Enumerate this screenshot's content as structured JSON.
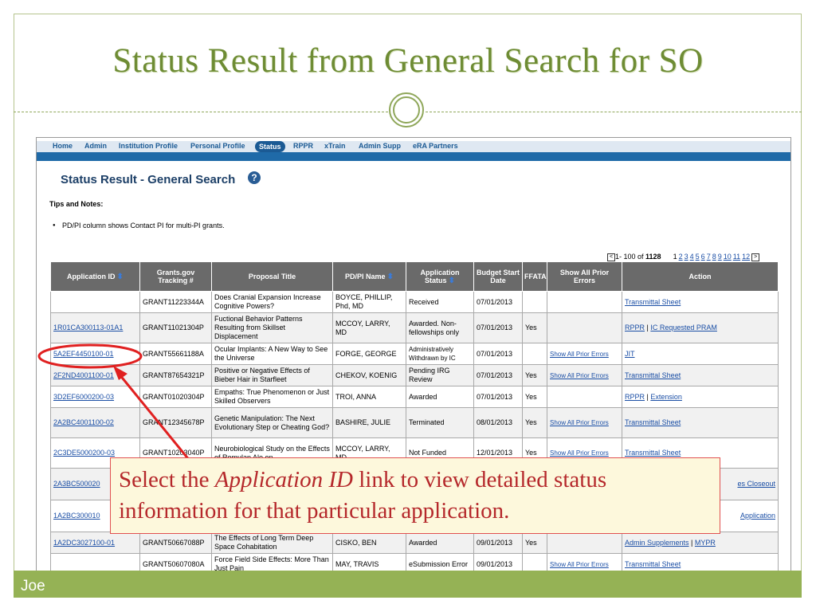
{
  "slide": {
    "title": "Status Result from General Search for SO",
    "footer": "Joe",
    "callout": {
      "pre": "Select the ",
      "emph": "Application ID",
      "post": " link to view detailed status information for that particular application."
    }
  },
  "colors": {
    "accent": "#6e8c34",
    "nav_blue": "#1f6aa8",
    "callout_text": "#b5282b",
    "highlight_circle": "#e02020"
  },
  "nav": {
    "items": [
      "Home",
      "Admin",
      "Institution Profile",
      "Personal Profile",
      "Status",
      "RPPR",
      "xTrain",
      "Admin Supp",
      "eRA Partners"
    ],
    "active": "Status"
  },
  "page": {
    "heading": "Status Result - General Search",
    "help_icon": "?",
    "tips_title": "Tips and Notes:",
    "tips": [
      "PD/PI column shows Contact PI for multi-PI grants."
    ]
  },
  "pager": {
    "range": "1- 100 of ",
    "total": "1128",
    "pages": [
      "1",
      "2",
      "3",
      "4",
      "5",
      "6",
      "7",
      "8",
      "9",
      "10",
      "11",
      "12"
    ]
  },
  "table": {
    "headers": [
      "Application ID",
      "Grants.gov Tracking #",
      "Proposal Title",
      "PD/PI Name",
      "Application Status",
      "Budget Start Date",
      "FFATA",
      "Show All Prior Errors",
      "Action"
    ],
    "rows": [
      {
        "app_id": "",
        "tracking": "GRANT11223344A",
        "title": "Does Cranial Expansion Increase Cognitive Powers?",
        "pi": "BOYCE, PHILLIP, Phd, MD",
        "status": "Received",
        "date": "07/01/2013",
        "ffata": "",
        "errors": "",
        "actions": [
          "Transmittal Sheet"
        ]
      },
      {
        "app_id": "1R01CA300113-01A1",
        "tracking": "GRANT11021304P",
        "title": "Fuctional Behavior Patterns Resulting from Skillset Displacement",
        "pi": "MCCOY, LARRY, MD",
        "status": "Awarded. Non-fellowships only",
        "date": "07/01/2013",
        "ffata": "Yes",
        "errors": "",
        "actions": [
          "RPPR",
          "IC Requested PRAM"
        ]
      },
      {
        "app_id": "5A2EF4450100-01",
        "tracking": "GRANT55661188A",
        "title": "Ocular Implants: A New Way to See the Universe",
        "pi": "FORGE, GEORGE",
        "status": "Administratively Withdrawn by IC",
        "date": "07/01/2013",
        "ffata": "",
        "errors": "Show All Prior Errors",
        "actions": [
          "JIT"
        ]
      },
      {
        "app_id": "2F2ND4001100-01",
        "tracking": "GRANT87654321P",
        "title": "Positive or Negative Effects of Bieber Hair in Starfleet",
        "pi": "CHEKOV, KOENIG",
        "status": "Pending IRG Review",
        "date": "07/01/2013",
        "ffata": "Yes",
        "errors": "Show All Prior Errors",
        "actions": [
          "Transmittal Sheet"
        ]
      },
      {
        "app_id": "3D2EF6000200-03",
        "tracking": "GRANT01020304P",
        "title": "Empaths: True Phenomenon or Just Skilled Observers",
        "pi": "TROI, ANNA",
        "status": "Awarded",
        "date": "07/01/2013",
        "ffata": "Yes",
        "errors": "",
        "actions": [
          "RPPR",
          "Extension"
        ]
      },
      {
        "app_id": "2A2BC4001100-02",
        "tracking": "GRANT12345678P",
        "title": "Genetic Manipulation: The Next Evolutionary Step or Cheating God?",
        "pi": "BASHIRE, JULIE",
        "status": "Terminated",
        "date": "08/01/2013",
        "ffata": "Yes",
        "errors": "Show All Prior Errors",
        "actions": [
          "Transmittal Sheet"
        ]
      },
      {
        "app_id": "2C3DE5000200-03",
        "tracking": "GRANT10203040P",
        "title": "Neurobiological Study on the Effects of Romulan Ale on",
        "pi": "MCCOY, LARRY, MD",
        "status": "Not Funded",
        "date": "12/01/2013",
        "ffata": "Yes",
        "errors": "Show All Prior Errors",
        "actions": [
          "Transmittal Sheet"
        ]
      },
      {
        "app_id": "2A3BC500020",
        "tracking": "",
        "title": "",
        "pi": "",
        "status": "",
        "date": "",
        "ffata": "",
        "errors": "",
        "actions": [
          "es Closeout"
        ]
      },
      {
        "app_id": "1A2BC300010",
        "tracking": "",
        "title": "",
        "pi": "",
        "status": "",
        "date": "",
        "ffata": "",
        "errors": "",
        "actions": [
          "Application"
        ]
      },
      {
        "app_id": "1A2DC3027100-01",
        "tracking": "GRANT50667088P",
        "title": "The Effects of Long Term Deep Space Cohabitation",
        "pi": "CISKO, BEN",
        "status": "Awarded",
        "date": "09/01/2013",
        "ffata": "Yes",
        "errors": "",
        "actions": [
          "Admin Supplements",
          "MYPR"
        ]
      },
      {
        "app_id": "",
        "tracking": "GRANT50607080A",
        "title": "Force Field Side Effects: More Than Just Pain",
        "pi": "MAY, TRAVIS",
        "status": "eSubmission Error",
        "date": "09/01/2013",
        "ffata": "",
        "errors": "Show All Prior Errors",
        "actions": [
          "Transmittal Sheet"
        ]
      }
    ]
  }
}
